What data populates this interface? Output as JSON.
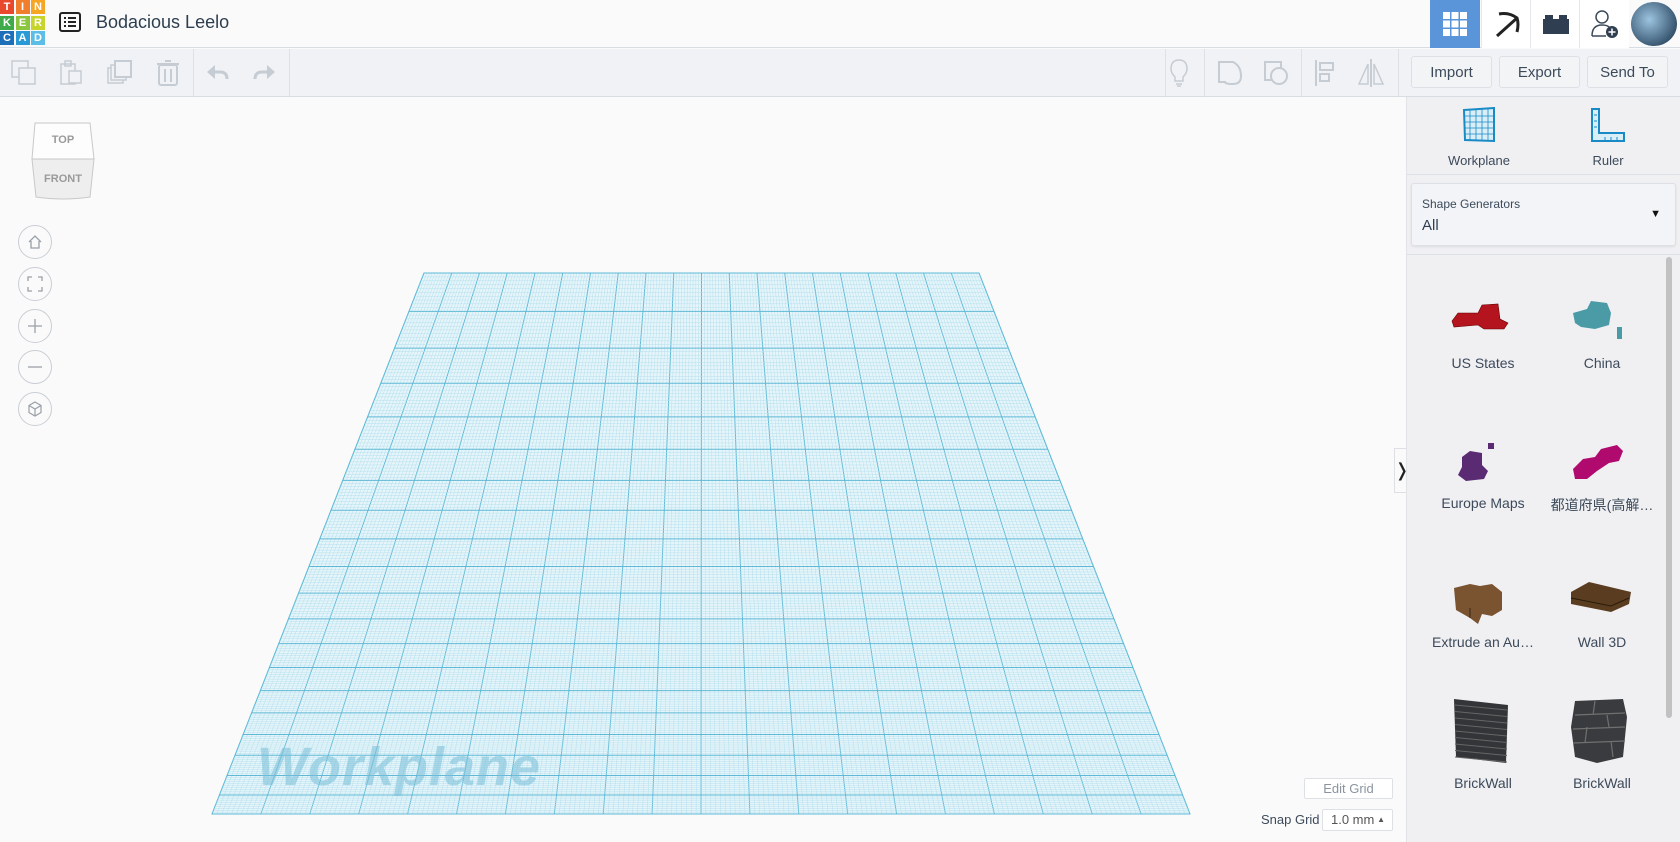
{
  "header": {
    "logo": [
      "T",
      "I",
      "N",
      "K",
      "E",
      "R",
      "C",
      "A",
      "D"
    ],
    "title": "Bodacious Leelo"
  },
  "toolbar": {
    "import": "Import",
    "export": "Export",
    "send_to": "Send To"
  },
  "viewcube": {
    "top": "TOP",
    "front": "FRONT"
  },
  "workplane": {
    "watermark": "Workplane",
    "edit_grid": "Edit Grid",
    "snap_grid_label": "Snap Grid",
    "snap_grid_value": "1.0 mm"
  },
  "panel": {
    "workplane": "Workplane",
    "ruler": "Ruler",
    "category_label": "Shape Generators",
    "category_value": "All",
    "items": [
      {
        "label": "US States",
        "color": "#b3141d"
      },
      {
        "label": "China",
        "color": "#4a9ba5"
      },
      {
        "label": "Europe Maps",
        "color": "#5a2a73"
      },
      {
        "label": "都道府県(高解…",
        "color": "#b00a6e"
      },
      {
        "label": "Extrude an Au…",
        "color": "#7a5330"
      },
      {
        "label": "Wall 3D",
        "color": "#5a3d20"
      },
      {
        "label": "BrickWall",
        "color": "#333538"
      },
      {
        "label": "BrickWall",
        "color": "#3a3b3e"
      }
    ]
  },
  "colors": {
    "accent": "#5b95d9",
    "grid": "#6cc6e0"
  }
}
